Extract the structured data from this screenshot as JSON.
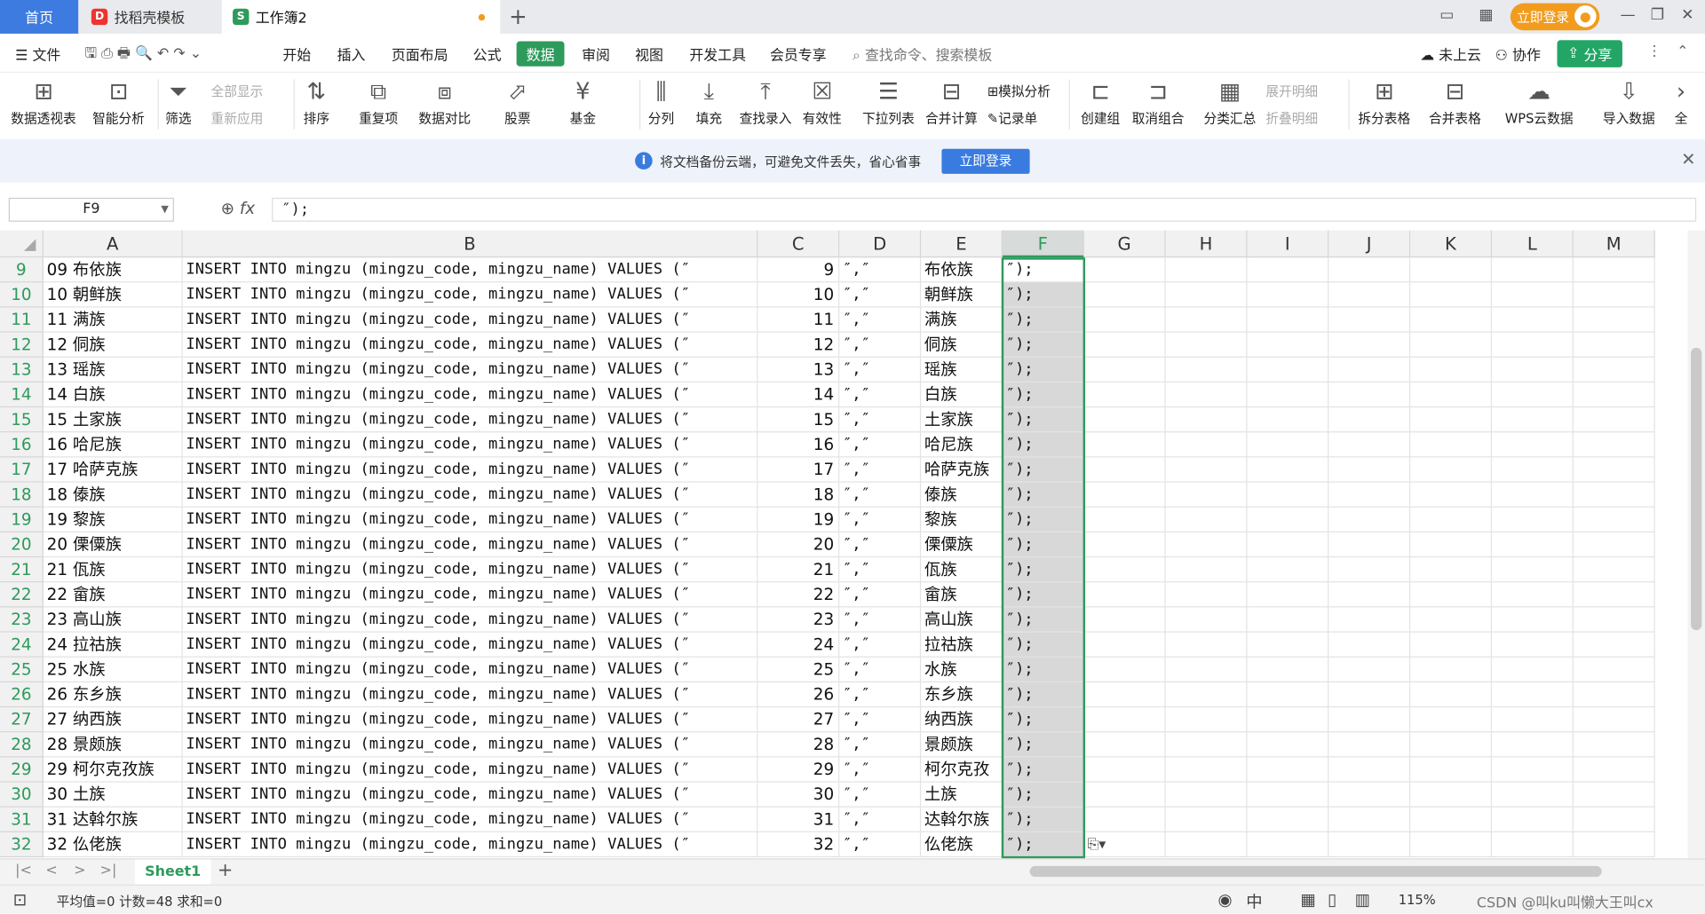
{
  "tabs": {
    "home": "首页",
    "templates": "找稻壳模板",
    "workbook": "工作簿2",
    "new_tab": "+"
  },
  "titlebar": {
    "login": "立即登录"
  },
  "menu": {
    "file": "文件",
    "items": [
      "开始",
      "插入",
      "页面布局",
      "公式",
      "数据",
      "审阅",
      "视图",
      "开发工具",
      "会员专享"
    ],
    "active": "数据",
    "search": "查找命令、搜索模板",
    "cloud": "未上云",
    "collab": "协作",
    "share": "分享"
  },
  "ribbon": {
    "pivot": "数据透视表",
    "smart": "智能分析",
    "filter": "筛选",
    "show_all": "全部显示",
    "reapply": "重新应用",
    "sort": "排序",
    "dup": "重复项",
    "compare": "数据对比",
    "stock": "股票",
    "fund": "基金",
    "split": "分列",
    "fill": "填充",
    "lookup": "查找录入",
    "valid": "有效性",
    "dropdown": "下拉列表",
    "consolidate": "合并计算",
    "simulate": "模拟分析",
    "record": "记录单",
    "group": "创建组",
    "ungroup": "取消组合",
    "subtotal": "分类汇总",
    "expand": "展开明细",
    "collapse": "折叠明细",
    "split_table": "拆分表格",
    "merge_table": "合并表格",
    "wps_cloud": "WPS云数据",
    "import": "导入数据",
    "more": "全"
  },
  "notice": {
    "text": "将文档备份云端，可避免文件丢失，省心省事",
    "button": "立即登录"
  },
  "formula": {
    "cell_ref": "F9",
    "fx": "fx",
    "content": "″);"
  },
  "columns": [
    "A",
    "B",
    "C",
    "D",
    "E",
    "F",
    "G",
    "H",
    "I",
    "J",
    "K",
    "L",
    "M"
  ],
  "rows": [
    {
      "n": "9",
      "a": "09 布依族",
      "b": "INSERT INTO mingzu (mingzu_code, mingzu_name) VALUES (″",
      "c": "9",
      "d": "″,″",
      "e": "布依族",
      "f": "″);"
    },
    {
      "n": "10",
      "a": "10 朝鲜族",
      "b": "INSERT INTO mingzu (mingzu_code, mingzu_name) VALUES (″",
      "c": "10",
      "d": "″,″",
      "e": "朝鲜族",
      "f": "″);"
    },
    {
      "n": "11",
      "a": "11 满族",
      "b": "INSERT INTO mingzu (mingzu_code, mingzu_name) VALUES (″",
      "c": "11",
      "d": "″,″",
      "e": "满族",
      "f": "″);"
    },
    {
      "n": "12",
      "a": "12 侗族",
      "b": "INSERT INTO mingzu (mingzu_code, mingzu_name) VALUES (″",
      "c": "12",
      "d": "″,″",
      "e": "侗族",
      "f": "″);"
    },
    {
      "n": "13",
      "a": "13 瑶族",
      "b": "INSERT INTO mingzu (mingzu_code, mingzu_name) VALUES (″",
      "c": "13",
      "d": "″,″",
      "e": "瑶族",
      "f": "″);"
    },
    {
      "n": "14",
      "a": "14 白族",
      "b": "INSERT INTO mingzu (mingzu_code, mingzu_name) VALUES (″",
      "c": "14",
      "d": "″,″",
      "e": "白族",
      "f": "″);"
    },
    {
      "n": "15",
      "a": "15 土家族",
      "b": "INSERT INTO mingzu (mingzu_code, mingzu_name) VALUES (″",
      "c": "15",
      "d": "″,″",
      "e": "土家族",
      "f": "″);"
    },
    {
      "n": "16",
      "a": "16 哈尼族",
      "b": "INSERT INTO mingzu (mingzu_code, mingzu_name) VALUES (″",
      "c": "16",
      "d": "″,″",
      "e": "哈尼族",
      "f": "″);"
    },
    {
      "n": "17",
      "a": "17 哈萨克族",
      "b": "INSERT INTO mingzu (mingzu_code, mingzu_name) VALUES (″",
      "c": "17",
      "d": "″,″",
      "e": "哈萨克族",
      "f": "″);"
    },
    {
      "n": "18",
      "a": "18 傣族",
      "b": "INSERT INTO mingzu (mingzu_code, mingzu_name) VALUES (″",
      "c": "18",
      "d": "″,″",
      "e": "傣族",
      "f": "″);"
    },
    {
      "n": "19",
      "a": "19 黎族",
      "b": "INSERT INTO mingzu (mingzu_code, mingzu_name) VALUES (″",
      "c": "19",
      "d": "″,″",
      "e": "黎族",
      "f": "″);"
    },
    {
      "n": "20",
      "a": "20 傈僳族",
      "b": "INSERT INTO mingzu (mingzu_code, mingzu_name) VALUES (″",
      "c": "20",
      "d": "″,″",
      "e": "傈僳族",
      "f": "″);"
    },
    {
      "n": "21",
      "a": "21 佤族",
      "b": "INSERT INTO mingzu (mingzu_code, mingzu_name) VALUES (″",
      "c": "21",
      "d": "″,″",
      "e": "佤族",
      "f": "″);"
    },
    {
      "n": "22",
      "a": "22 畲族",
      "b": "INSERT INTO mingzu (mingzu_code, mingzu_name) VALUES (″",
      "c": "22",
      "d": "″,″",
      "e": "畲族",
      "f": "″);"
    },
    {
      "n": "23",
      "a": "23 高山族",
      "b": "INSERT INTO mingzu (mingzu_code, mingzu_name) VALUES (″",
      "c": "23",
      "d": "″,″",
      "e": "高山族",
      "f": "″);"
    },
    {
      "n": "24",
      "a": "24 拉祜族",
      "b": "INSERT INTO mingzu (mingzu_code, mingzu_name) VALUES (″",
      "c": "24",
      "d": "″,″",
      "e": "拉祜族",
      "f": "″);"
    },
    {
      "n": "25",
      "a": "25 水族",
      "b": "INSERT INTO mingzu (mingzu_code, mingzu_name) VALUES (″",
      "c": "25",
      "d": "″,″",
      "e": "水族",
      "f": "″);"
    },
    {
      "n": "26",
      "a": "26 东乡族",
      "b": "INSERT INTO mingzu (mingzu_code, mingzu_name) VALUES (″",
      "c": "26",
      "d": "″,″",
      "e": "东乡族",
      "f": "″);"
    },
    {
      "n": "27",
      "a": "27 纳西族",
      "b": "INSERT INTO mingzu (mingzu_code, mingzu_name) VALUES (″",
      "c": "27",
      "d": "″,″",
      "e": "纳西族",
      "f": "″);"
    },
    {
      "n": "28",
      "a": "28 景颇族",
      "b": "INSERT INTO mingzu (mingzu_code, mingzu_name) VALUES (″",
      "c": "28",
      "d": "″,″",
      "e": "景颇族",
      "f": "″);"
    },
    {
      "n": "29",
      "a": "29 柯尔克孜族",
      "b": "INSERT INTO mingzu (mingzu_code, mingzu_name) VALUES (″",
      "c": "29",
      "d": "″,″",
      "e": "柯尔克孜",
      "f": "″);"
    },
    {
      "n": "30",
      "a": "30 土族",
      "b": "INSERT INTO mingzu (mingzu_code, mingzu_name) VALUES (″",
      "c": "30",
      "d": "″,″",
      "e": "土族",
      "f": "″);"
    },
    {
      "n": "31",
      "a": "31 达斡尔族",
      "b": "INSERT INTO mingzu (mingzu_code, mingzu_name) VALUES (″",
      "c": "31",
      "d": "″,″",
      "e": "达斡尔族",
      "f": "″);"
    },
    {
      "n": "32",
      "a": "32 仫佬族",
      "b": "INSERT INTO mingzu (mingzu_code, mingzu_name) VALUES (″",
      "c": "32",
      "d": "″,″",
      "e": "仫佬族",
      "f": "″);"
    }
  ],
  "sheet": {
    "name": "Sheet1"
  },
  "status": {
    "summary": "平均值=0 计数=48 求和=0",
    "zoom": "115%",
    "watermark": "CSDN @叫ku叫懒大王叫cx"
  },
  "colors": {
    "accent_green": "#2e9a5c",
    "brand_blue": "#3d7be0",
    "login_orange": "#f29c1f"
  }
}
